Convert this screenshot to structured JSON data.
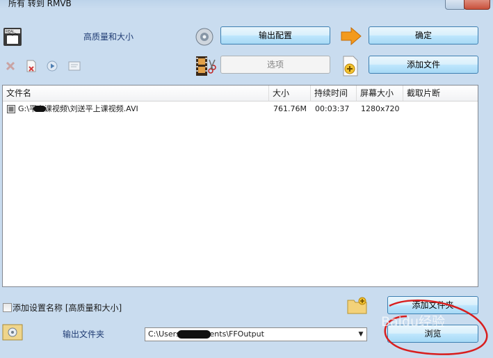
{
  "window": {
    "title": "所有 转到 RMVB"
  },
  "profile": {
    "label": "高质量和大小"
  },
  "toolbar": {
    "output_config_label": "输出配置",
    "ok_label": "确定",
    "options_label": "选项",
    "add_file_label": "添加文件"
  },
  "file_list": {
    "columns": [
      "文件名",
      "大小",
      "持续时间",
      "屏幕大小",
      "截取片断"
    ],
    "rows": [
      {
        "name": "G:\\平上课视频\\刘送平上课视频.AVI",
        "size": "761.76M",
        "duration": "00:03:37",
        "resolution": "1280x720",
        "clip": ""
      }
    ]
  },
  "add_setting_name": {
    "label": "添加设置名称 [高质量和大小]",
    "checked": false
  },
  "add_folder_label": "添加文件夹",
  "output_folder": {
    "label": "输出文件夹",
    "path": "C:\\Users\\Documents\\FFOutput",
    "browse_label": "浏览"
  },
  "watermark": {
    "text": "Baidu经验"
  },
  "colors": {
    "accent_blue": "#3c7fb1",
    "label_blue": "#1f3b73",
    "annotation_red": "#d81e1e"
  }
}
